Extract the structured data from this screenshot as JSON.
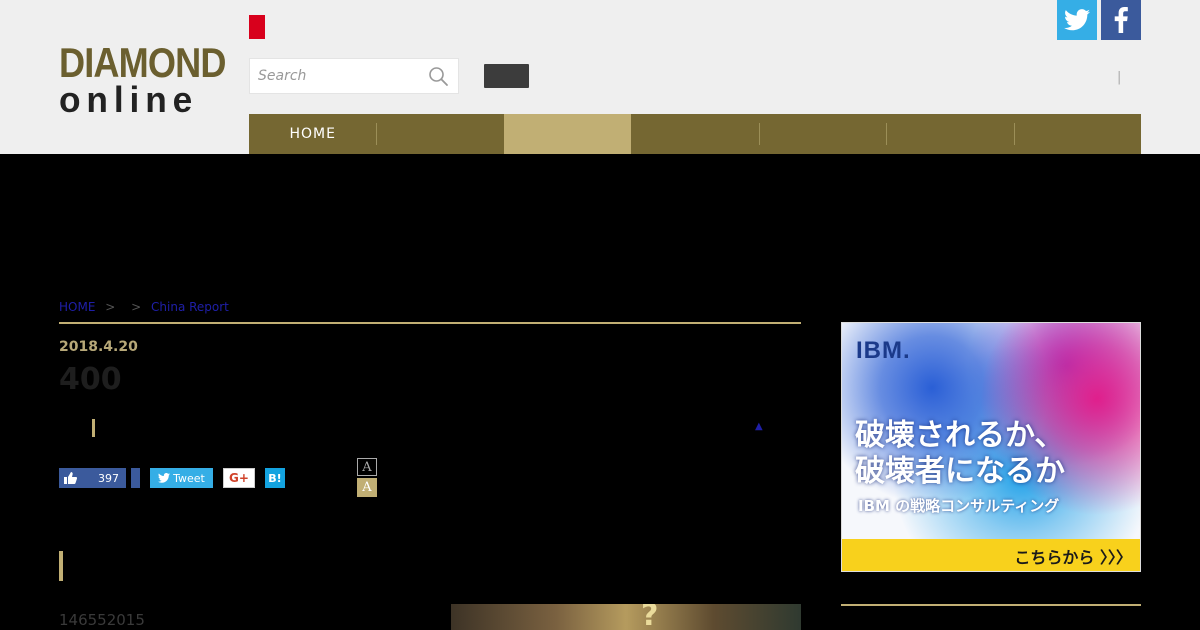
{
  "header": {
    "logo_line1": "DIAMOND",
    "logo_line2": "online",
    "search_placeholder": "Search",
    "separator": "|"
  },
  "nav": {
    "items": [
      "HOME",
      "",
      "",
      "",
      "",
      "",
      ""
    ],
    "active_index": 2
  },
  "breadcrumb": {
    "home": "HOME",
    "arrow1": ">",
    "arrow2": ">",
    "current": "China Report"
  },
  "article": {
    "date": "2018.4.20",
    "title": "400",
    "up_arrow": "▲",
    "body_text": "146552015"
  },
  "share": {
    "like_count": "397",
    "tweet_label": "Tweet",
    "gplus_label": "G+",
    "hatena_label": "B!"
  },
  "font_size": {
    "small_label": "A",
    "large_label": "A"
  },
  "ad": {
    "brand": "IBM.",
    "headline_line1": "破壊されるか、",
    "headline_line2": "破壊者になるか",
    "subline": "IBM の戦略コンサルティング",
    "cta": "こちらから 〉〉〉"
  },
  "colors": {
    "nav_bg": "#756732",
    "nav_active": "#c1af74",
    "accent_gold": "#c1af74",
    "twitter": "#35aee6",
    "facebook": "#3b5a9c",
    "brand_red": "#d8001c"
  }
}
